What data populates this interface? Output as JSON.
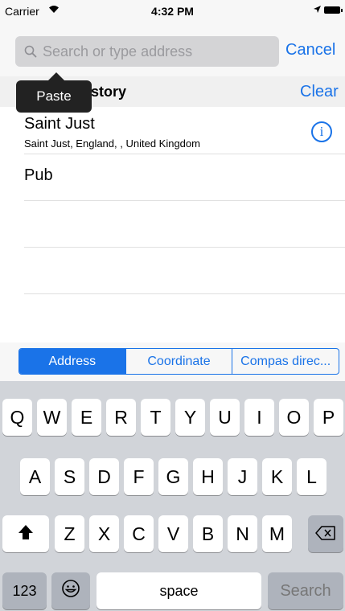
{
  "status_bar": {
    "carrier": "Carrier",
    "wifi_icon": "wifi-icon",
    "time": "4:32 PM",
    "location_icon": "location-arrow-icon",
    "battery_icon": "battery-icon"
  },
  "search": {
    "placeholder": "Search or type address",
    "value": "",
    "cancel_label": "Cancel"
  },
  "tooltip": {
    "label": "Paste"
  },
  "history": {
    "title_partial": "story",
    "clear_label": "Clear",
    "items": [
      {
        "title": "Saint Just",
        "subtitle": "Saint Just, England, , United Kingdom"
      },
      {
        "title": "Pub",
        "subtitle": ""
      }
    ]
  },
  "segments": {
    "items": [
      "Address",
      "Coordinate",
      "Compas direc..."
    ],
    "selected": "Address"
  },
  "keyboard": {
    "row1": [
      "Q",
      "W",
      "E",
      "R",
      "T",
      "Y",
      "U",
      "I",
      "O",
      "P"
    ],
    "row2": [
      "A",
      "S",
      "D",
      "F",
      "G",
      "H",
      "J",
      "K",
      "L"
    ],
    "row3": [
      "Z",
      "X",
      "C",
      "V",
      "B",
      "N",
      "M"
    ],
    "numbers_key": "123",
    "space_key": "space",
    "search_key": "Search"
  },
  "colors": {
    "accent": "#1a73e8",
    "keyboard_bg": "#d1d4d9",
    "search_bg": "#d4d4d6"
  }
}
